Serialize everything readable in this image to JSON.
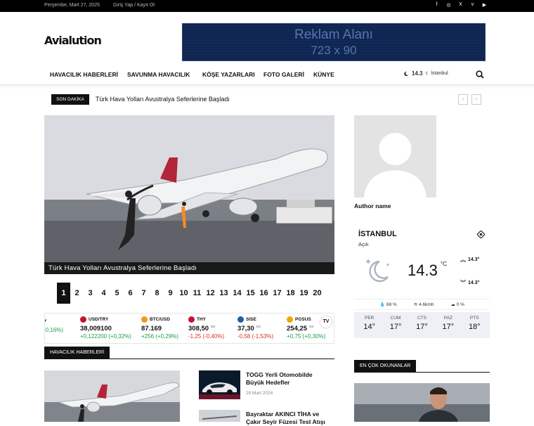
{
  "topbar": {
    "date": "Perşembe, Mart 27, 2025",
    "login": "Giriş Yap / Kayıt Ol",
    "social": [
      {
        "icon": "facebook-icon",
        "glyph": "f"
      },
      {
        "icon": "instagram-icon",
        "glyph": "◎"
      },
      {
        "icon": "x-icon",
        "glyph": "X"
      },
      {
        "icon": "vimeo-icon",
        "glyph": "v"
      },
      {
        "icon": "youtube-icon",
        "glyph": "▶"
      }
    ]
  },
  "logo": {
    "text": "Avialution"
  },
  "ad": {
    "line1": "Reklam Alanı",
    "line2": "723 x 90"
  },
  "nav": {
    "items": [
      "HAVACILIK HABERLERİ",
      "SAVUNMA HAVACILIK",
      "KÖŞE YAZARLARI",
      "FOTO GALERİ",
      "KÜNYE"
    ],
    "weather_temp": "14.3",
    "weather_unit": "C",
    "weather_city": "İstanbul"
  },
  "ticker": {
    "label": "SON DAKİKA",
    "headline": "Türk Hava Yolları Avustralya Seferlerine Başladı",
    "prev": "‹",
    "next": "›"
  },
  "hero": {
    "caption": "Türk Hava Yolları Avustralya Seferlerine Başladı"
  },
  "pager": {
    "pages": [
      "1",
      "2",
      "3",
      "4",
      "5",
      "6",
      "7",
      "8",
      "9",
      "10",
      "11",
      "12",
      "13",
      "14",
      "15",
      "16",
      "17",
      "18",
      "19",
      "20"
    ],
    "active": "1"
  },
  "markets": [
    {
      "name": "",
      "value": "",
      "change": "+0,16%)",
      "dir": "up",
      "color": "#999",
      "partial": true
    },
    {
      "name": "USD/TRY",
      "value": "38,009100",
      "change": "+0,122200 (+0,32%)",
      "dir": "up",
      "color": "#c8102e"
    },
    {
      "name": "BTC/USD",
      "value": "87.169",
      "change": "+256 (+0,29%)",
      "dir": "up",
      "color": "#f7931a"
    },
    {
      "name": "THY",
      "value": "308,50",
      "change": "-1,25 (-0,40%)",
      "dir": "dn",
      "color": "#c8102e",
      "suffix": "GS"
    },
    {
      "name": "SISE",
      "value": "37,30",
      "change": "-0,58 (-1,53%)",
      "dir": "dn",
      "color": "#1f5fa8",
      "suffix": "GS"
    },
    {
      "name": "PGSUS",
      "value": "254,25",
      "change": "+0,75 (+0,30%)",
      "dir": "up",
      "color": "#f5a300",
      "suffix": "GS"
    }
  ],
  "markets_widget_badge": "TV",
  "sections": {
    "havacilik": "HAVACILIK HABERLERİ",
    "most_read": "EN ÇOK OKUNANLAR"
  },
  "news": [
    {
      "title": "TOGG Yerli Otomobilde Büyük Hedefler",
      "date": "29 Mart 2024"
    },
    {
      "title": "Bayraktar AKINCI TİHA ve Çakır Seyir Füzesi Test Atışı",
      "date": ""
    }
  ],
  "author": {
    "name": "Author name"
  },
  "weather": {
    "city": "İSTANBUL",
    "desc": "Açık",
    "temp": "14.3",
    "unit": "°C",
    "high": "14.3°",
    "low": "14.3°",
    "humidity": "68 %",
    "wind": "4.6kmh",
    "clouds": "0 %",
    "days": [
      {
        "name": "PER",
        "temp": "14°"
      },
      {
        "name": "CUM",
        "temp": "17°"
      },
      {
        "name": "CTS",
        "temp": "17°"
      },
      {
        "name": "PAZ",
        "temp": "17°"
      },
      {
        "name": "PTS",
        "temp": "18°"
      }
    ]
  }
}
